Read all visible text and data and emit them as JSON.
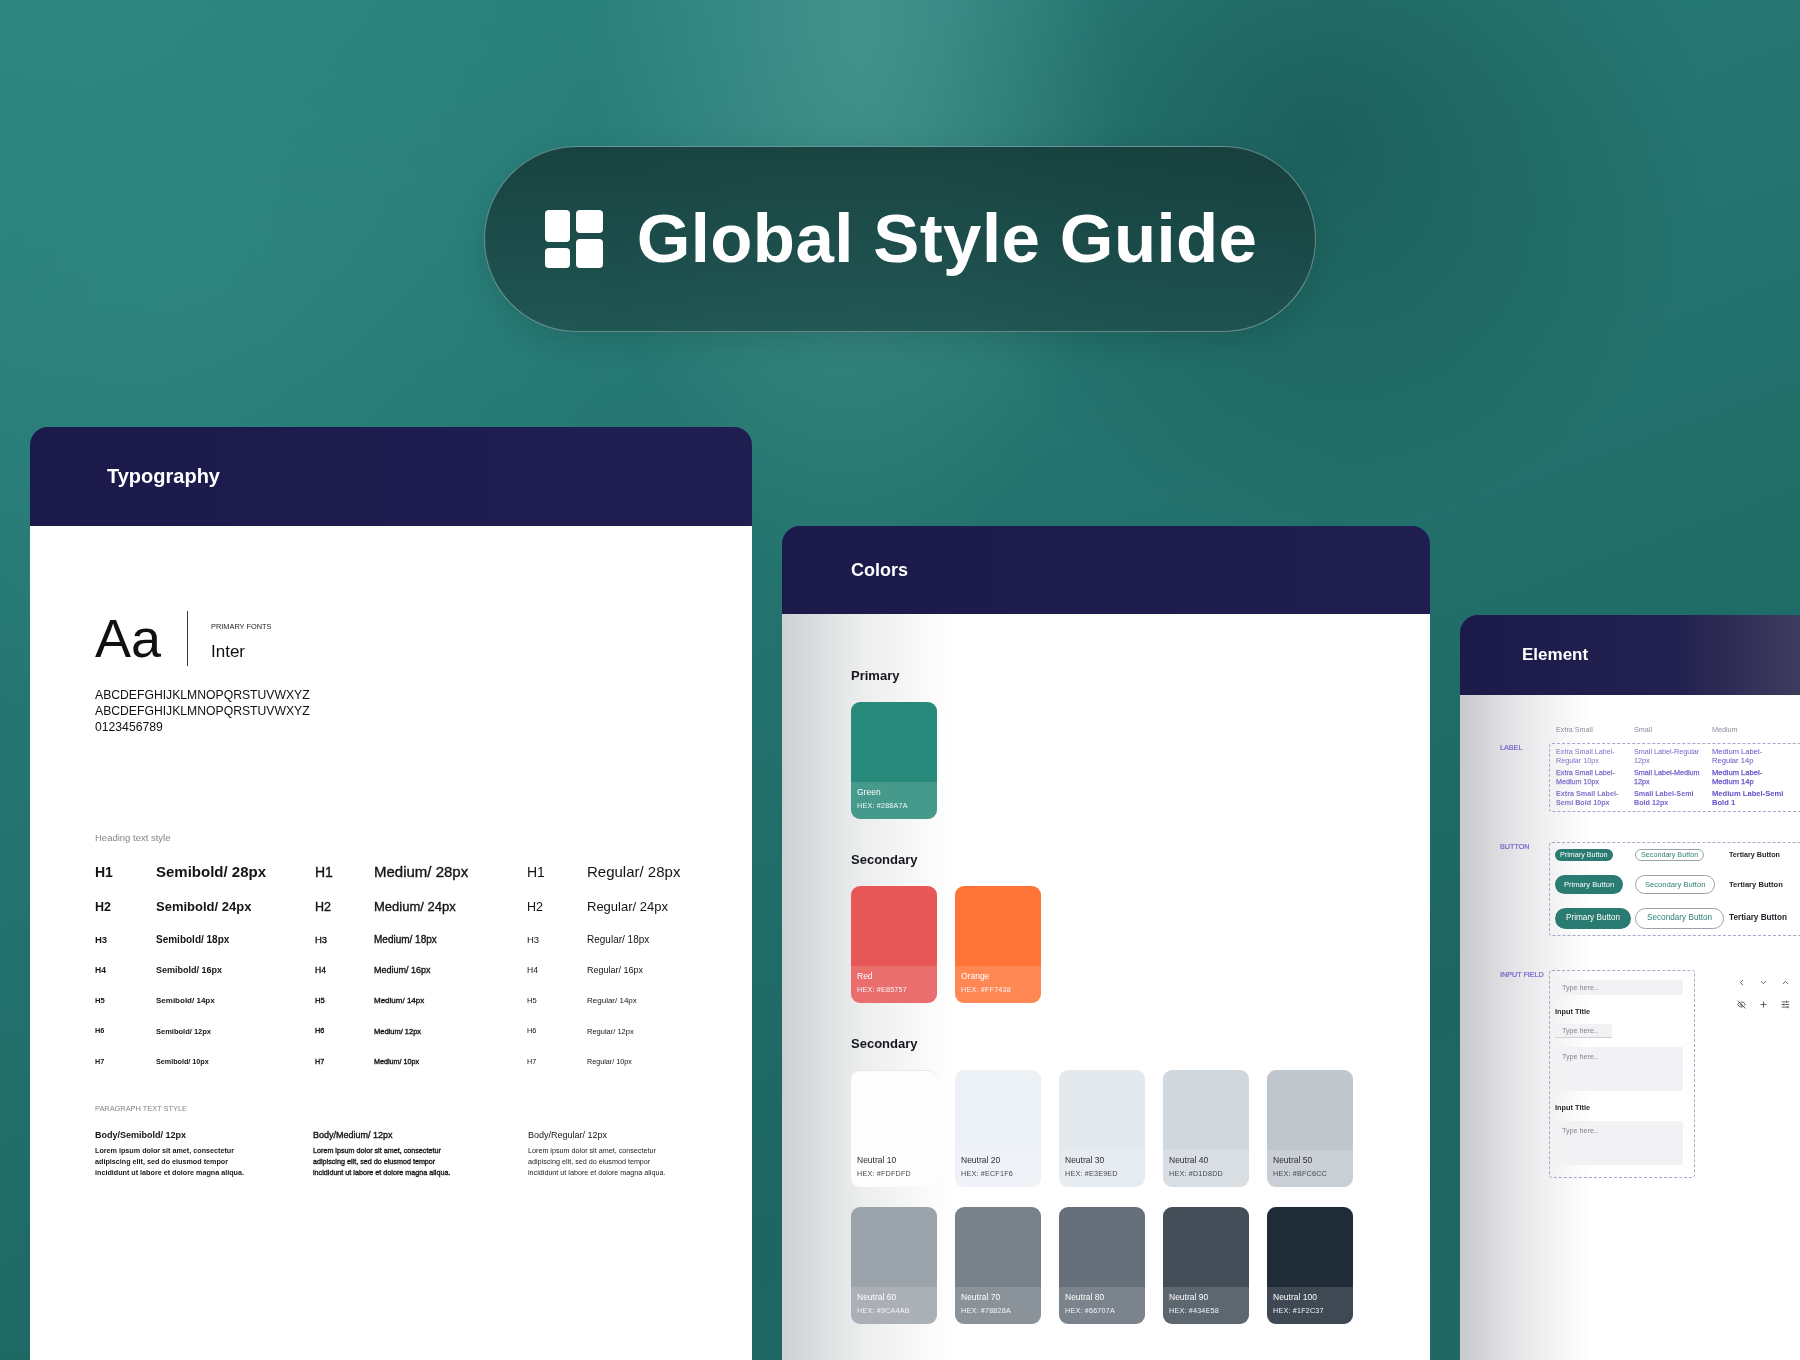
{
  "banner": {
    "title": "Global Style Guide"
  },
  "typography": {
    "title": "Typography",
    "sample": "Aa",
    "font_caption": "PRIMARY FONTS",
    "font_name": "Inter",
    "character_set": [
      "ABCDEFGHIJKLMNOPQRSTUVWXYZ",
      "ABCDEFGHIJKLMNOPQRSTUVWXYZ",
      "0123456789"
    ],
    "heading_caption": "Heading text style",
    "heading_columns": [
      {
        "kind": "semibold",
        "rows": [
          {
            "tag": "H1",
            "style": "Semibold/ 28px"
          },
          {
            "tag": "H2",
            "style": "Semibold/ 24px"
          },
          {
            "tag": "H3",
            "style": "Semibold/ 18px"
          },
          {
            "tag": "H4",
            "style": "Semibold/ 16px"
          },
          {
            "tag": "H5",
            "style": "Semibold/ 14px"
          },
          {
            "tag": "H6",
            "style": "Semibold/ 12px"
          },
          {
            "tag": "H7",
            "style": "Semibold/ 10px"
          }
        ]
      },
      {
        "kind": "medium",
        "rows": [
          {
            "tag": "H1",
            "style": "Medium/ 28px"
          },
          {
            "tag": "H2",
            "style": "Medium/ 24px"
          },
          {
            "tag": "H3",
            "style": "Medium/ 18px"
          },
          {
            "tag": "H4",
            "style": "Medium/ 16px"
          },
          {
            "tag": "H5",
            "style": "Medium/ 14px"
          },
          {
            "tag": "H6",
            "style": "Medium/ 12px"
          },
          {
            "tag": "H7",
            "style": "Medium/ 10px"
          }
        ]
      },
      {
        "kind": "regular",
        "rows": [
          {
            "tag": "H1",
            "style": "Regular/ 28px"
          },
          {
            "tag": "H2",
            "style": "Regular/ 24px"
          },
          {
            "tag": "H3",
            "style": "Regular/ 18px"
          },
          {
            "tag": "H4",
            "style": "Regular/ 16px"
          },
          {
            "tag": "H5",
            "style": "Regular/ 14px"
          },
          {
            "tag": "H6",
            "style": "Regular/ 12px"
          },
          {
            "tag": "H7",
            "style": "Regular/ 10px"
          }
        ]
      }
    ],
    "paragraph_caption": "PARAGRAPH TEXT STYLE",
    "paragraph_styles": [
      {
        "kind": "semibold",
        "name": "Body/Semibold/ 12px",
        "sample": "Lorem ipsum dolor sit amet, consectetur adipiscing elit, sed do eiusmod tempor incididunt ut labore et dolore magna aliqua."
      },
      {
        "kind": "medium",
        "name": "Body/Medium/ 12px",
        "sample": "Lorem ipsum dolor sit amet, consectetur adipiscing elit, sed do eiusmod tempor incididunt ut labore et dolore magna aliqua."
      },
      {
        "kind": "regular",
        "name": "Body/Regular/ 12px",
        "sample": "Lorem ipsum dolor sit amet, consectetur adipiscing elit, sed do eiusmod tempor incididunt ut labore et dolore magna aliqua."
      }
    ]
  },
  "colors": {
    "title": "Colors",
    "groups": [
      {
        "heading": "Primary",
        "swatches": [
          {
            "name": "Green",
            "hex": "HEX: #288A7A",
            "color": "#288a7a"
          }
        ]
      },
      {
        "heading": "Secondary",
        "swatches": [
          {
            "name": "Red",
            "hex": "HEX: #E85757",
            "color": "#e85757"
          },
          {
            "name": "Orange",
            "hex": "HEX: #FF7438",
            "color": "#ff7438"
          }
        ]
      },
      {
        "heading": "Secondary",
        "swatches": [
          {
            "name": "Neutral 10",
            "hex": "HEX: #FDFDFD",
            "color": "#fdfdfd"
          },
          {
            "name": "Neutral 20",
            "hex": "HEX: #ECF1F6",
            "color": "#ecf1f6"
          },
          {
            "name": "Neutral 30",
            "hex": "HEX: #E3E9ED",
            "color": "#e3e9ed"
          },
          {
            "name": "Neutral 40",
            "hex": "HEX: #D1D8DD",
            "color": "#d1d8dd"
          },
          {
            "name": "Neutral 50",
            "hex": "HEX: #BFC6CC",
            "color": "#bfc6cc"
          },
          {
            "name": "Neutral 60",
            "hex": "HEX: #9CA4AB",
            "color": "#9ca4ab"
          },
          {
            "name": "Neutral 70",
            "hex": "HEX: #78828A",
            "color": "#78828a"
          },
          {
            "name": "Neutral 80",
            "hex": "HEX: #66707A",
            "color": "#66707a"
          },
          {
            "name": "Neutral 90",
            "hex": "HEX: #434E58",
            "color": "#434e58"
          },
          {
            "name": "Neutral 100",
            "hex": "HEX: #1F2C37",
            "color": "#1f2c37"
          }
        ]
      }
    ]
  },
  "element": {
    "title": "Element",
    "size_headings": [
      "Extra Small",
      "Small",
      "Medium"
    ],
    "label_section": {
      "heading": "LABEL",
      "rows": [
        [
          "Extra Small Label-Regular 10px",
          "Small Label-Regular 12px",
          "Medium Label-Regular 14p"
        ],
        [
          "Extra Small Label-Medium 10px",
          "Small Label-Medium 12px",
          "Medium Label-Medium 14p"
        ],
        [
          "Extra Small Label-Semi Bold 10px",
          "Small Label-Semi Bold 12px",
          "Medium Label-Semi Bold 1"
        ]
      ]
    },
    "button_section": {
      "heading": "BUTTON",
      "rows": [
        [
          {
            "kind": "primary",
            "label": "Primary Button"
          },
          {
            "kind": "secondary",
            "label": "Secondary Button"
          },
          {
            "kind": "tertiary",
            "label": "Tertiary Button"
          }
        ],
        [
          {
            "kind": "primary",
            "label": "Primary Button"
          },
          {
            "kind": "secondary",
            "label": "Secondary Button"
          },
          {
            "kind": "tertiary",
            "label": "Tertiary Button"
          }
        ],
        [
          {
            "kind": "primary",
            "label": "Primary Button"
          },
          {
            "kind": "secondary",
            "label": "Secondary Button"
          },
          {
            "kind": "tertiary",
            "label": "Tertiary Button"
          }
        ]
      ]
    },
    "input_section": {
      "heading": "INPUT FIELD",
      "items": [
        {
          "kind": "input",
          "placeholder": "Type here.."
        },
        {
          "kind": "title",
          "text": "Input Title"
        },
        {
          "kind": "underlined",
          "placeholder": "Type here.."
        },
        {
          "kind": "textarea",
          "placeholder": "Type here.."
        },
        {
          "kind": "title",
          "text": "Input Title"
        },
        {
          "kind": "textarea",
          "placeholder": "Type here.."
        }
      ]
    }
  }
}
